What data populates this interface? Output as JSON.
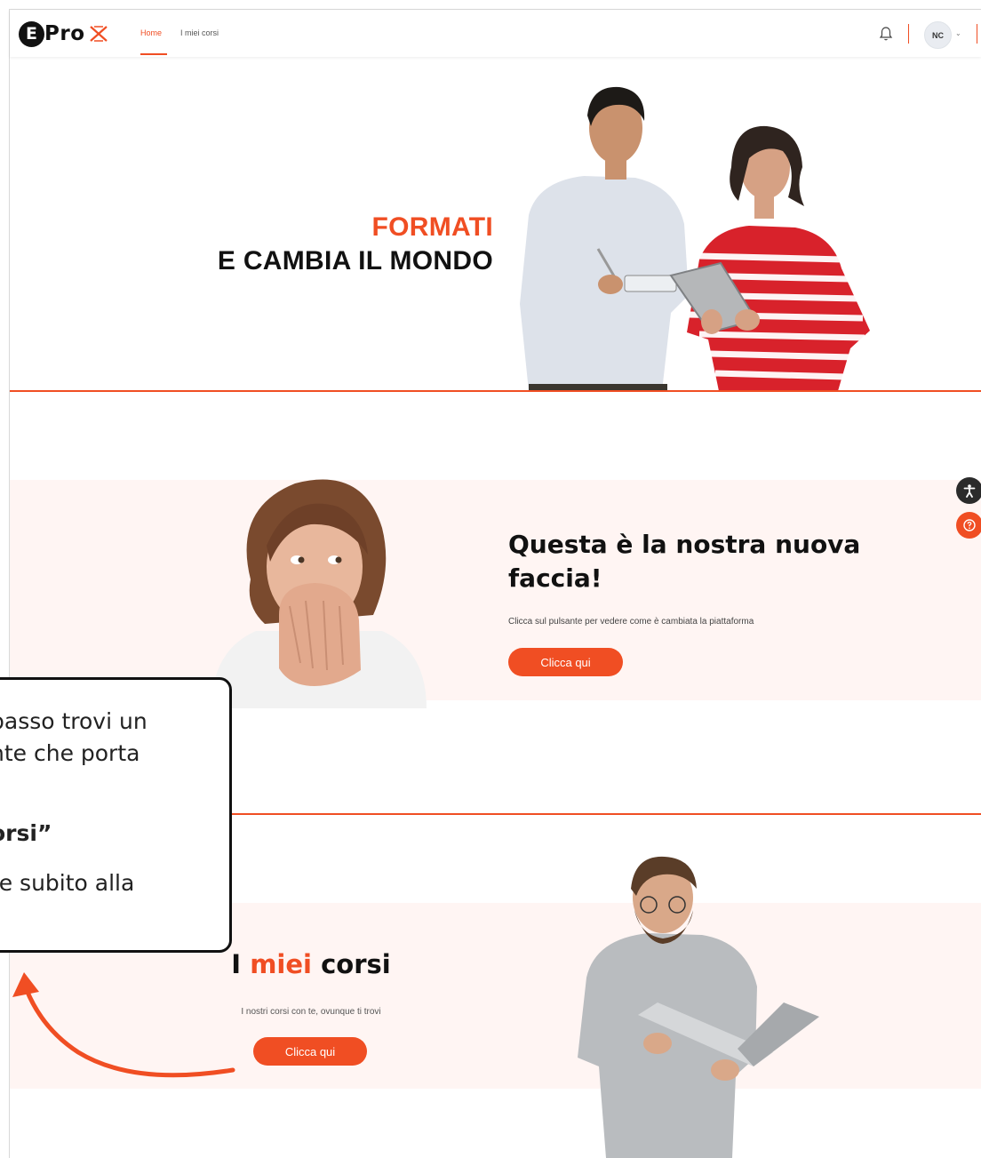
{
  "nav": {
    "logo_text": "Pro",
    "logo_letter": "E",
    "links": [
      {
        "label": "Home",
        "active": true
      },
      {
        "label": "I miei corsi",
        "active": false
      }
    ],
    "avatar_initials": "NC",
    "caret": "⌄"
  },
  "hero": {
    "title_line1": "FORMATI",
    "title_line2": "E CAMBIA IL MONDO"
  },
  "section_new_face": {
    "title": "Questa è la nostra nuova faccia!",
    "subtitle": "Clicca sul pulsante per vedere come è cambiata la piattaforma",
    "button_label": "Clicca qui"
  },
  "section_my_courses": {
    "title_prefix": "I",
    "title_highlight": "miei",
    "title_suffix": "corsi",
    "subtitle": "I nostri corsi con te, ovunque ti trovi",
    "button_label": "Clicca qui"
  },
  "callout": {
    "line1": "passo trovi un",
    "line2": "nte che porta",
    "line3": "orsi”",
    "line4": "re subito alla"
  },
  "icons": {
    "bell": "bell-icon",
    "accessibility": "accessibility-icon",
    "help": "help-icon"
  },
  "colors": {
    "accent": "#f04e23",
    "band": "#fff5f3",
    "dark": "#111111"
  }
}
